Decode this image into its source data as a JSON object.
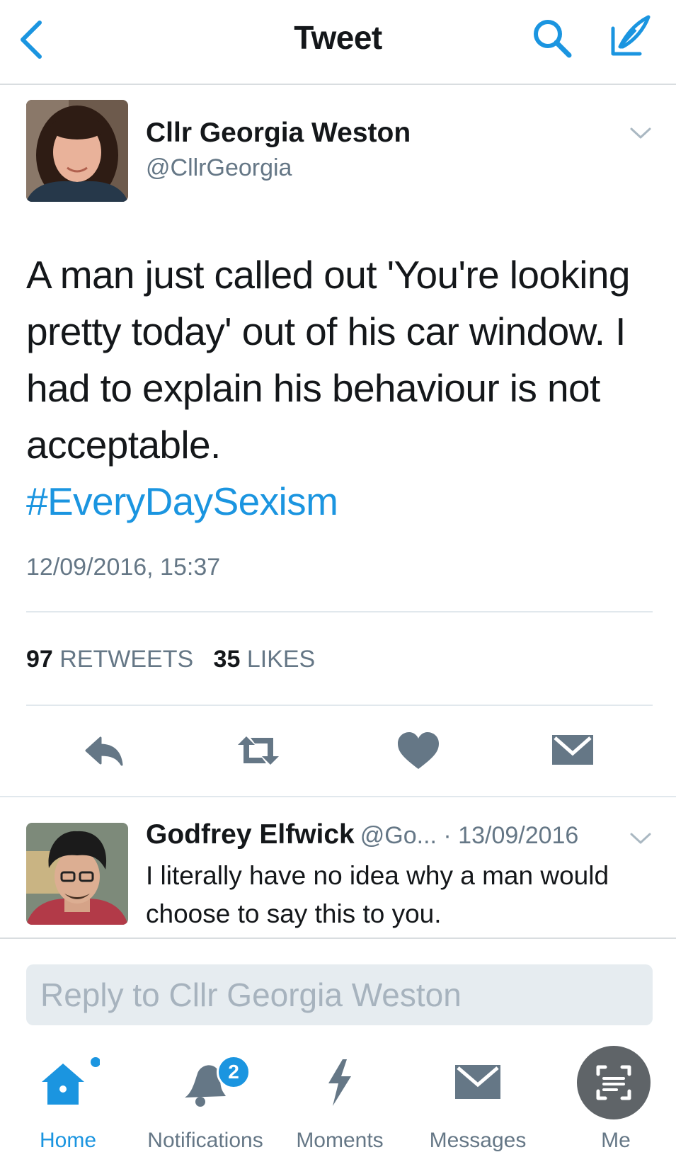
{
  "header": {
    "title": "Tweet",
    "back_icon": "chevron-left-icon",
    "search_icon": "search-icon",
    "compose_icon": "compose-icon",
    "accent_color": "#1b95e0"
  },
  "tweet": {
    "author_name": "Cllr Georgia Weston",
    "author_handle": "@CllrGeorgia",
    "text": "A man just called out 'You're looking pretty today' out of his car window. I had to explain his behaviour is not acceptable.",
    "hashtag": "#EveryDaySexism",
    "timestamp": "12/09/2016, 15:37",
    "retweet_count": "97",
    "retweet_label": "RETWEETS",
    "like_count": "35",
    "like_label": "LIKES"
  },
  "reply": {
    "author_name": "Godfrey Elfwick",
    "meta": "@Go... · 13/09/2016",
    "text": "I literally have no idea why a man would choose to say this to you."
  },
  "composer": {
    "placeholder": "Reply to Cllr Georgia Weston"
  },
  "tabs": [
    {
      "label": "Home",
      "icon": "home-icon",
      "active": true
    },
    {
      "label": "Notifications",
      "icon": "bell-icon",
      "badge": "2"
    },
    {
      "label": "Moments",
      "icon": "lightning-icon"
    },
    {
      "label": "Messages",
      "icon": "envelope-icon"
    },
    {
      "label": "Me",
      "icon": "person-icon"
    }
  ]
}
